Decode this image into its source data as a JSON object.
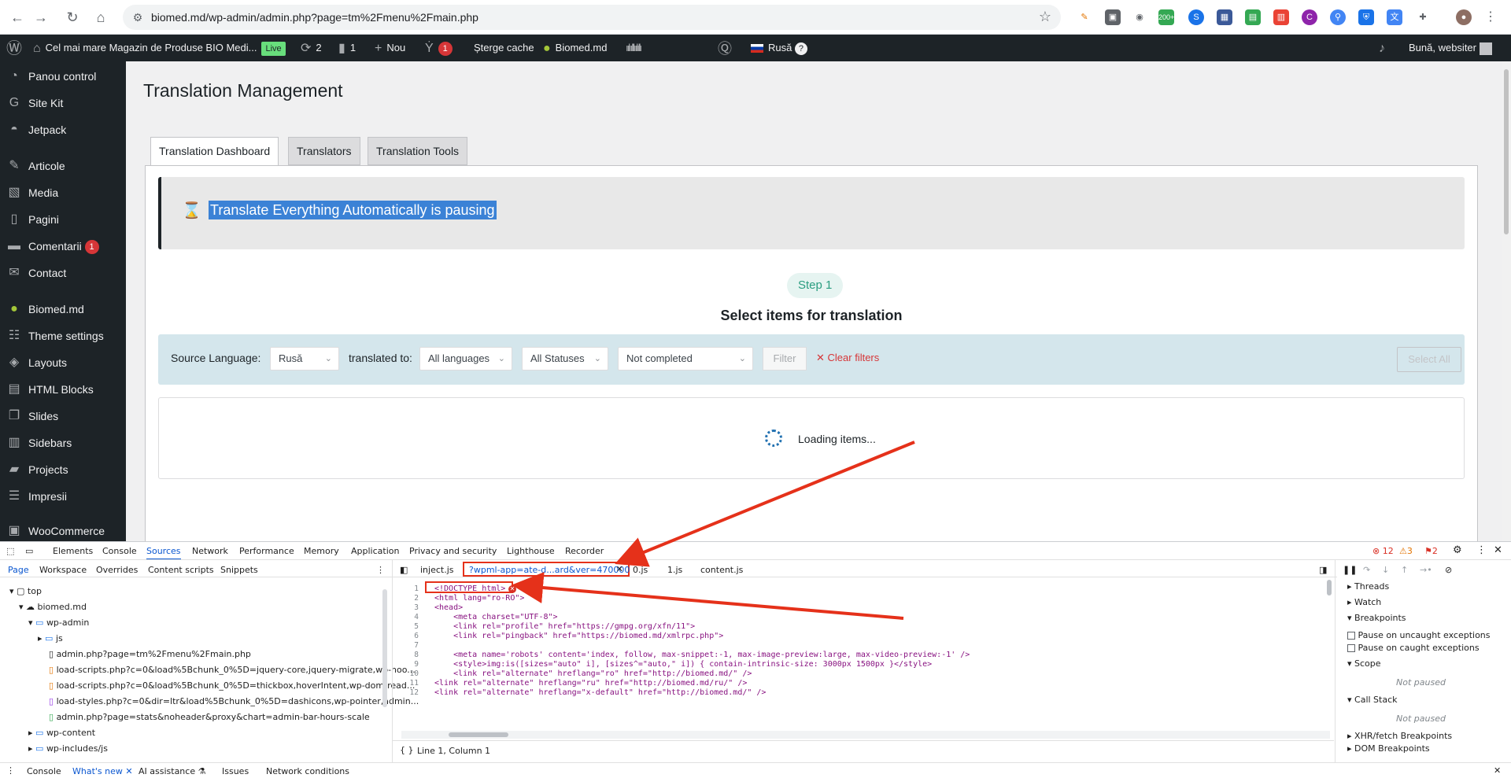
{
  "browser": {
    "url": "biomed.md/wp-admin/admin.php?page=tm%2Fmenu%2Fmain.php",
    "ext_badge": "200+"
  },
  "adminbar": {
    "site_name": "Cel mai mare Magazin de Produse BIO Medi...",
    "live": "Live",
    "updates": "2",
    "comments": "1",
    "new": "Nou",
    "yoast_count": "1",
    "clear_cache": "Șterge cache",
    "biomed": "Biomed.md",
    "language": "Rusă",
    "greeting": "Bună, websiter"
  },
  "sidebar": {
    "items": [
      {
        "label": "Panou control",
        "icon": "dashboard-icon"
      },
      {
        "label": "Site Kit",
        "icon": "sitekit-icon"
      },
      {
        "label": "Jetpack",
        "icon": "jetpack-icon"
      },
      {
        "label": "Articole",
        "icon": "pin-icon"
      },
      {
        "label": "Media",
        "icon": "media-icon"
      },
      {
        "label": "Pagini",
        "icon": "page-icon"
      },
      {
        "label": "Comentarii",
        "icon": "comment-icon",
        "badge": "1"
      },
      {
        "label": "Contact",
        "icon": "mail-icon"
      },
      {
        "label": "Biomed.md",
        "icon": "biomed-icon"
      },
      {
        "label": "Theme settings",
        "icon": "sliders-icon"
      },
      {
        "label": "Layouts",
        "icon": "layers-icon"
      },
      {
        "label": "HTML Blocks",
        "icon": "html-icon"
      },
      {
        "label": "Slides",
        "icon": "slides-icon"
      },
      {
        "label": "Sidebars",
        "icon": "sidebar-icon"
      },
      {
        "label": "Projects",
        "icon": "briefcase-icon"
      },
      {
        "label": "Impresii",
        "icon": "list-icon"
      },
      {
        "label": "WooCommerce",
        "icon": "woo-icon"
      }
    ]
  },
  "main": {
    "title": "Translation Management",
    "tabs": [
      "Translation Dashboard",
      "Translators",
      "Translation Tools"
    ],
    "notice": "Translate Everything Automatically is pausing",
    "step_pill": "Step 1",
    "step_title": "Select items for translation",
    "filters": {
      "source_label": "Source Language:",
      "source_value": "Rusă",
      "translated_label": "translated to:",
      "translated_value": "All languages",
      "status_value": "All Statuses",
      "completion_value": "Not completed",
      "filter_button": "Filter",
      "clear_filters": "Clear filters",
      "select_all": "Select All"
    },
    "loading": "Loading items..."
  },
  "devtools": {
    "tabs": [
      "Elements",
      "Console",
      "Sources",
      "Network",
      "Performance",
      "Memory",
      "Application",
      "Privacy and security",
      "Lighthouse",
      "Recorder"
    ],
    "errors": "12",
    "warnings": "3",
    "issues": "2",
    "subtabs": [
      "Page",
      "Workspace",
      "Overrides",
      "Content scripts",
      "Snippets"
    ],
    "tree": [
      "top",
      "biomed.md",
      "wp-admin",
      "js",
      "admin.php?page=tm%2Fmenu%2Fmain.php",
      "load-scripts.php?c=0&load%5Bchunk_0%5D=jquery-core,jquery-migrate,wp-hoo...",
      "load-scripts.php?c=0&load%5Bchunk_0%5D=thickbox,hoverIntent,wp-dom-read...",
      "load-styles.php?c=0&dir=ltr&load%5Bchunk_0%5D=dashicons,wp-pointer,admin...",
      "admin.php?page=stats&noheader&proxy&chart=admin-bar-hours-scale",
      "wp-content",
      "wp-includes/js"
    ],
    "file_tabs": [
      "inject.js",
      "?wpml-app=ate-d...ard&ver=470000",
      "0.js",
      "1.js",
      "content.js"
    ],
    "code_lines": [
      "<!DOCTYPE html>",
      "<html lang=\"ro-RO\">",
      "<head>",
      "    <meta charset=\"UTF-8\">",
      "    <link rel=\"profile\" href=\"https://gmpg.org/xfn/11\">",
      "    <link rel=\"pingback\" href=\"https://biomed.md/xmlrpc.php\">",
      "",
      "    <meta name='robots' content='index, follow, max-snippet:-1, max-image-preview:large, max-video-preview:-1' />",
      "    <style>img:is([sizes=\"auto\" i], [sizes^=\"auto,\" i]) { contain-intrinsic-size: 3000px 1500px }</style>",
      "    <link rel=\"alternate\" hreflang=\"ro\" href=\"http://biomed.md/\" />",
      "<link rel=\"alternate\" hreflang=\"ru\" href=\"http://biomed.md/ru/\" />",
      "<link rel=\"alternate\" hreflang=\"x-default\" href=\"http://biomed.md/\" />"
    ],
    "status": "Line 1, Column 1",
    "right_panel": {
      "threads": "Threads",
      "watch": "Watch",
      "breakpoints": "Breakpoints",
      "pause_uncaught": "Pause on uncaught exceptions",
      "pause_caught": "Pause on caught exceptions",
      "scope": "Scope",
      "not_paused": "Not paused",
      "call_stack": "Call Stack",
      "not_paused2": "Not paused",
      "xhr": "XHR/fetch Breakpoints",
      "dom": "DOM Breakpoints"
    },
    "drawer_tabs": [
      "Console",
      "What's new",
      "AI assistance",
      "Issues",
      "Network conditions"
    ]
  }
}
